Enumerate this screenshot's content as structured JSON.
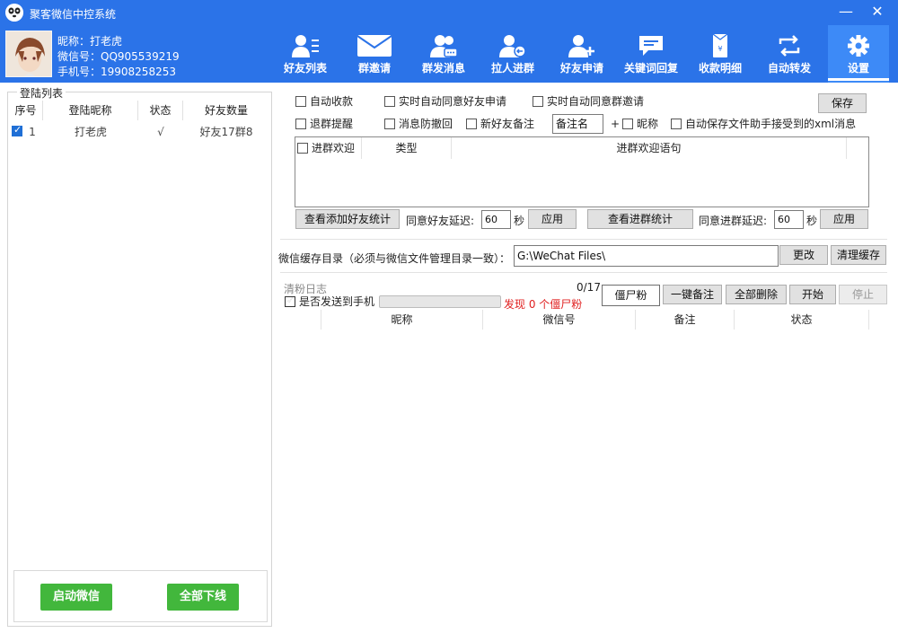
{
  "window": {
    "title": "聚客微信中控系统",
    "minimize": "—",
    "close": "✕"
  },
  "user": {
    "nickname_line": "昵称：打老虎",
    "wechat_line": "微信号：QQ905539219",
    "phone_line": "手机号：19908258253"
  },
  "nav": [
    {
      "label": "好友列表",
      "icon": "friends-list-icon"
    },
    {
      "label": "群邀请",
      "icon": "envelope-icon"
    },
    {
      "label": "群发消息",
      "icon": "group-chat-icon"
    },
    {
      "label": "拉人进群",
      "icon": "pull-user-icon"
    },
    {
      "label": "好友申请",
      "icon": "add-user-icon"
    },
    {
      "label": "关键词回复",
      "icon": "chat-bubble-icon"
    },
    {
      "label": "收款明细",
      "icon": "receipt-icon"
    },
    {
      "label": "自动转发",
      "icon": "repeat-icon"
    },
    {
      "label": "设置",
      "icon": "gear-icon",
      "active": true
    }
  ],
  "left": {
    "group_title": "登陆列表",
    "columns": [
      "序号",
      "登陆昵称",
      "状态",
      "好友数量"
    ],
    "rows": [
      {
        "checked": true,
        "index": "1",
        "nickname": "打老虎",
        "status": "√",
        "count": "好友17群8"
      }
    ],
    "start_button": "启动微信",
    "offline_button": "全部下线"
  },
  "settings": {
    "auto_receive": "自动收款",
    "auto_accept_friend": "实时自动同意好友申请",
    "auto_accept_group": "实时自动同意群邀请",
    "save": "保存",
    "leave_group_alert": "退群提醒",
    "anti_recall": "消息防撤回",
    "new_friend_remark": "新好友备注",
    "remark_value": "备注名",
    "plus": "+",
    "nickname": "昵称",
    "auto_save_xml": "自动保存文件助手接受到的xml消息",
    "welcome_cols": [
      "进群欢迎",
      "类型",
      "进群欢迎语句"
    ],
    "view_friend_stats": "查看添加好友统计",
    "friend_delay_label": "同意好友延迟:",
    "friend_delay_value": "60",
    "seconds": "秒",
    "apply": "应用",
    "view_group_stats": "查看进群统计",
    "group_delay_label": "同意进群延迟:",
    "group_delay_value": "60",
    "cache_label": "微信缓存目录（必须与微信文件管理目录一致）：",
    "cache_path": "G:\\WeChat Files\\",
    "change": "更改",
    "clear_cache": "清理缓存"
  },
  "clean": {
    "log_title": "清粉日志",
    "count": "0/17",
    "send_to_phone": "是否发送到手机",
    "progress": 0,
    "found": "发现 0 个僵尸粉",
    "zombie": "僵尸粉",
    "remark_all": "一键备注",
    "delete_all": "全部删除",
    "start": "开始",
    "stop": "停止",
    "columns": [
      "昵称",
      "微信号",
      "备注",
      "状态"
    ]
  },
  "colors": {
    "header_blue": "#2b73e8",
    "active_tab": "#3d8af7",
    "green": "#42b73c",
    "red_text": "#e02020"
  }
}
